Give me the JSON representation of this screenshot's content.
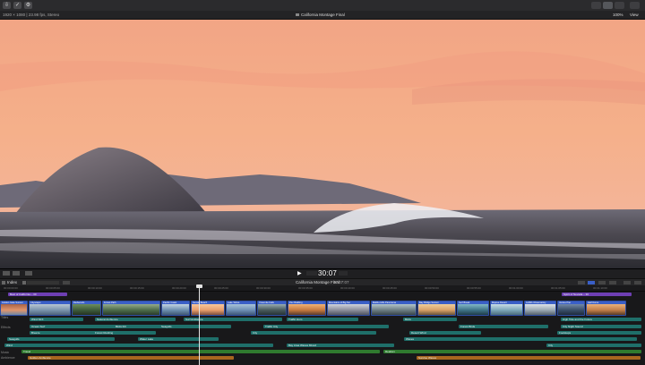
{
  "window": {
    "title": "California Montage Final",
    "format": "1920 × 1080 | 23.98 fps, Stereo",
    "zoom": "100%",
    "view_label": "View"
  },
  "timeline": {
    "index_label": "Index",
    "project_name": "California Montage Final",
    "duration": "07:07:07",
    "timecode": "30:07",
    "lanes": {
      "titles": "Titles",
      "effects": "Effects",
      "music": "Music",
      "ambience": "Ambience"
    },
    "markers": [
      {
        "label": "Best of California – 30"
      },
      {
        "label": "Spirit of Nevada – 30"
      }
    ],
    "video_clips": [
      {
        "label": "Golden Gate Sunset"
      },
      {
        "label": "Cityscape"
      },
      {
        "label": "Redwoods"
      },
      {
        "label": "Forest Path"
      },
      {
        "label": "Pacific Coast"
      },
      {
        "label": "Sunset Beach"
      },
      {
        "label": "Lake Tahoe"
      },
      {
        "label": "Yosemite Falls"
      },
      {
        "label": "Pier Building"
      },
      {
        "label": "Mountains of Big Sur"
      },
      {
        "label": "Malibu Hills Panorama"
      },
      {
        "label": "Bay Bridge Sunset"
      },
      {
        "label": "Surf Break"
      },
      {
        "label": "Mojave Desert"
      },
      {
        "label": "Griffith Observatory"
      },
      {
        "label": "Venice Pier"
      },
      {
        "label": "Half Dome"
      }
    ],
    "audio_clips": [
      {
        "label": "Wind SFX"
      },
      {
        "label": "Natural Ambience"
      },
      {
        "label": "Surf Ambience"
      },
      {
        "label": "Traffic Hum"
      },
      {
        "label": "Birds"
      },
      {
        "label": "High Tide and the Future"
      },
      {
        "label": "Ocean Surf"
      },
      {
        "label": "Birds Fill"
      },
      {
        "label": "Seagulls"
      },
      {
        "label": "Traffic City"
      },
      {
        "label": "Forest Birds"
      },
      {
        "label": "City Night Sound"
      },
      {
        "label": "Breeze"
      },
      {
        "label": "Forest Rustling"
      },
      {
        "label": "City"
      },
      {
        "label": "Desert Wind"
      },
      {
        "label": "Footsteps"
      },
      {
        "label": "Seagulls"
      },
      {
        "label": "Water Lake"
      },
      {
        "label": "Wind"
      },
      {
        "label": "Waves"
      },
      {
        "label": "Bay Area Waves Mixed"
      },
      {
        "label": "City"
      },
      {
        "label": "Travel"
      },
      {
        "label": "Realism"
      },
      {
        "label": "Golden Ambience"
      },
      {
        "label": "Sunrise Waves"
      }
    ],
    "ruler_ticks": [
      "00:00:00:00",
      "00:00:05:00",
      "00:00:10:00",
      "00:00:15:00",
      "00:00:20:00",
      "00:00:25:00",
      "00:00:30:00",
      "00:00:35:00",
      "00:00:40:00",
      "00:00:45:00",
      "00:00:50:00",
      "00:00:55:00",
      "00:01:00:00",
      "00:01:05:00",
      "00:01:10:00"
    ]
  },
  "colors": {
    "video_clip": "#3a5fc7",
    "audio_clip": "#1f6f6a",
    "music_clip": "#2f7a2f",
    "ambience_clip": "#a8661f",
    "marker": "#6e3fb3"
  }
}
